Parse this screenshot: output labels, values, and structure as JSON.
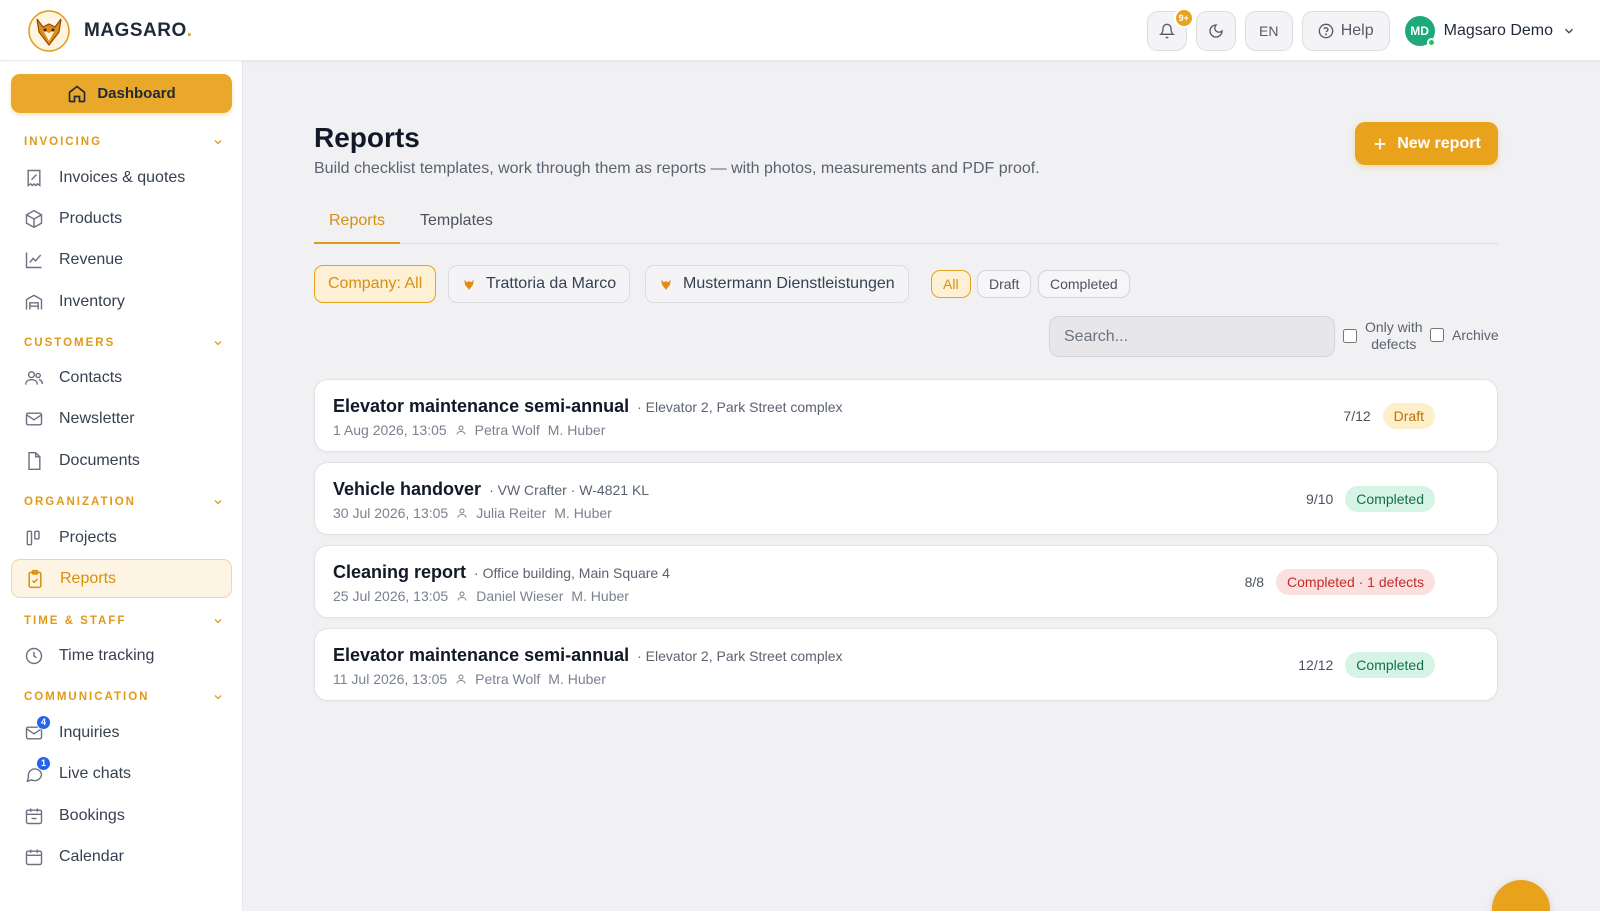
{
  "brand": {
    "name": "MAGSARO",
    "dot": "."
  },
  "header": {
    "notif_badge": "9+",
    "lang": "EN",
    "help_label": "Help",
    "user_initials": "MD",
    "user_name": "Magsaro Demo"
  },
  "sidebar": {
    "dashboard_label": "Dashboard",
    "sections": {
      "invoicing": "INVOICING",
      "customers": "CUSTOMERS",
      "organization": "ORGANIZATION",
      "time_staff": "TIME & STAFF",
      "communication": "COMMUNICATION"
    },
    "items": {
      "invoices": "Invoices & quotes",
      "products": "Products",
      "revenue": "Revenue",
      "inventory": "Inventory",
      "contacts": "Contacts",
      "newsletter": "Newsletter",
      "documents": "Documents",
      "projects": "Projects",
      "reports": "Reports",
      "time_tracking": "Time tracking",
      "inquiries": "Inquiries",
      "inquiries_badge": "4",
      "live_chats": "Live chats",
      "live_chats_badge": "1",
      "bookings": "Bookings",
      "calendar": "Calendar"
    },
    "accent_color": "#e9a21b"
  },
  "main": {
    "title": "Reports",
    "subtitle": "Build checklist templates, work through them as reports — with photos, measurements and PDF proof.",
    "new_button": "New report",
    "tabs": [
      "Reports",
      "Templates"
    ],
    "company_filters": [
      "Company: All",
      "Trattoria da Marco",
      "Mustermann Dienstleistungen"
    ],
    "status_filters": [
      "All",
      "Draft",
      "Completed"
    ],
    "search_placeholder": "Search...",
    "only_defects_line1": "Only with",
    "only_defects_line2": "defects",
    "archive_label": "Archive",
    "reports": [
      {
        "title": "Elevator maintenance semi-annual",
        "subtitle": "· Elevator 2, Park Street complex",
        "date": "1 Aug 2026, 13:05",
        "person": "Petra Wolf",
        "staff": "M. Huber",
        "count": "7/12",
        "status": "Draft"
      },
      {
        "title": "Vehicle handover",
        "subtitle": "· VW Crafter · W-4821 KL",
        "date": "30 Jul 2026, 13:05",
        "person": "Julia Reiter",
        "staff": "M. Huber",
        "count": "9/10",
        "status": "Completed"
      },
      {
        "title": "Cleaning report",
        "subtitle": "· Office building, Main Square 4",
        "date": "25 Jul 2026, 13:05",
        "person": "Daniel Wieser",
        "staff": "M. Huber",
        "count": "8/8",
        "status": "Completed · 1 defects"
      },
      {
        "title": "Elevator maintenance semi-annual",
        "subtitle": "· Elevator 2, Park Street complex",
        "date": "11 Jul 2026, 13:05",
        "person": "Petra Wolf",
        "staff": "M. Huber",
        "count": "12/12",
        "status": "Completed"
      }
    ]
  }
}
